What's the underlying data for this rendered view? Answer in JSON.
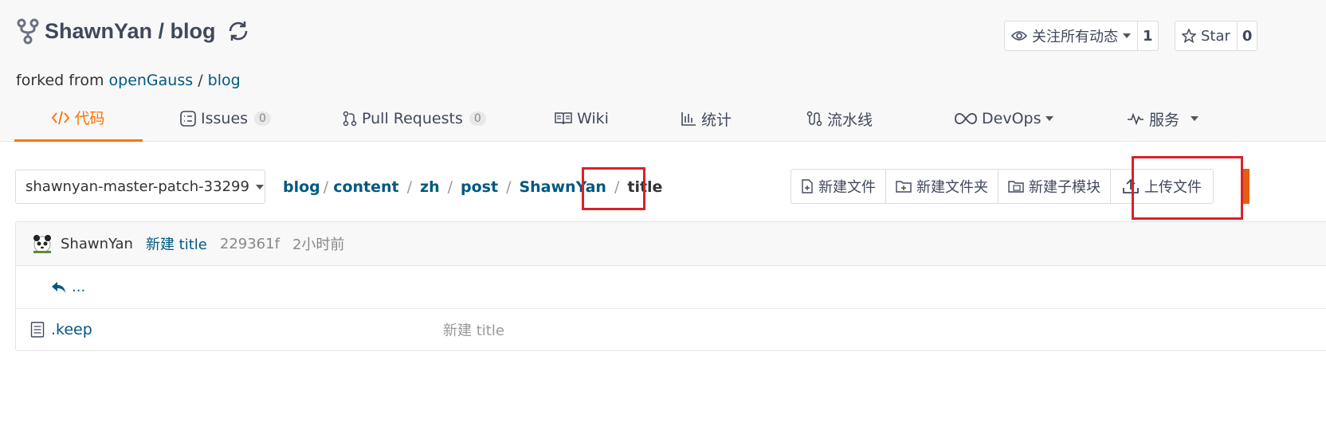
{
  "repo": {
    "title": "ShawnYan / blog",
    "forked_prefix": "forked from",
    "forked_owner": "openGauss",
    "forked_sep": "/",
    "forked_repo": "blog"
  },
  "watch": {
    "label": "关注所有动态",
    "count": "1"
  },
  "star": {
    "label": "Star",
    "count": "0"
  },
  "tabs": [
    {
      "label": "代码"
    },
    {
      "label": "Issues",
      "badge": "0"
    },
    {
      "label": "Pull Requests",
      "badge": "0"
    },
    {
      "label": "Wiki"
    },
    {
      "label": "统计"
    },
    {
      "label": "流水线"
    },
    {
      "label": "DevOps"
    },
    {
      "label": "服务"
    }
  ],
  "branch": "shawnyan-master-patch-33299",
  "breadcrumb": {
    "parts": [
      "blog",
      "content",
      "zh",
      "post",
      "ShawnYan"
    ],
    "current": "title",
    "sep": "/"
  },
  "actions": {
    "new_file": "新建文件",
    "new_folder": "新建文件夹",
    "new_submodule": "新建子模块",
    "upload": "上传文件"
  },
  "commit": {
    "author": "ShawnYan",
    "message": "新建 title",
    "sha": "229361f",
    "time": "2小时前"
  },
  "up_label": "...",
  "files": [
    {
      "name": ".keep",
      "message": "新建 title"
    }
  ],
  "colors": {
    "accent": "#fe7300",
    "link": "#005980",
    "highlight": "#d9222a"
  }
}
